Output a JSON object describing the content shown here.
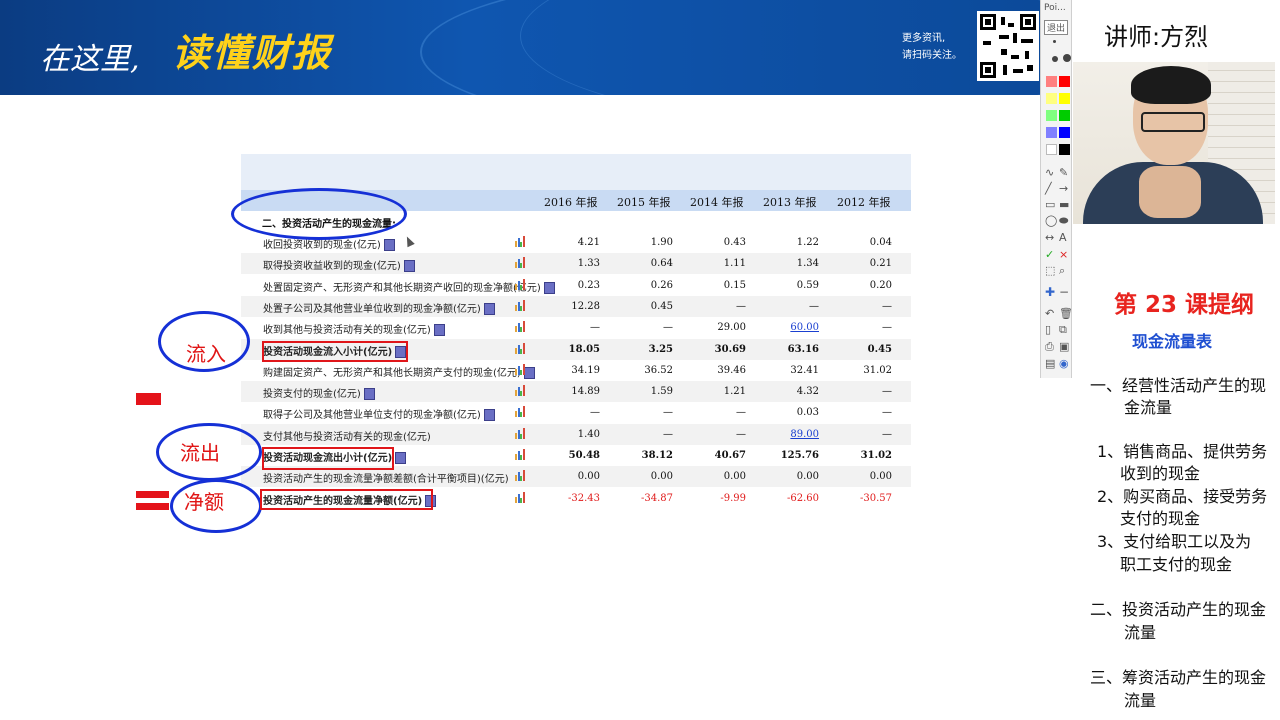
{
  "banner": {
    "slogan_white": "在这里,",
    "slogan_yellow": "读懂财报",
    "qr_text_1": "更多资讯,",
    "qr_text_2": "请扫码关注。"
  },
  "palette": {
    "top_label": "Poi...",
    "exit_label": "退出",
    "swatches": [
      "#ff8080",
      "#ff0000",
      "#ffff80",
      "#ffff00",
      "#80ff80",
      "#00cc00",
      "#8080ff",
      "#0000ff",
      "#ffffff",
      "#000000"
    ]
  },
  "teacher": "讲师:方烈",
  "outline": {
    "title": "第 23 课提纲",
    "subtitle": "现金流量表",
    "items": [
      "一、经营性活动产生的现",
      "金流量",
      "1、销售商品、提供劳务",
      "收到的现金",
      "2、购买商品、接受劳务",
      "支付的现金",
      "3、支付给职工以及为",
      "职工支付的现金",
      "二、投资活动产生的现金",
      "流量",
      "三、筹资活动产生的现金",
      "流量"
    ]
  },
  "table": {
    "years": [
      "2016 年报",
      "2015 年报",
      "2014 年报",
      "2013 年报",
      "2012 年报"
    ],
    "section_title": "二、投资活动产生的现金流量:",
    "rows": [
      {
        "label": "收回投资收到的现金(亿元)",
        "values": [
          "4.21",
          "1.90",
          "0.43",
          "1.22",
          "0.04"
        ]
      },
      {
        "label": "取得投资收益收到的现金(亿元)",
        "values": [
          "1.33",
          "0.64",
          "1.11",
          "1.34",
          "0.21"
        ]
      },
      {
        "label": "处置固定资产、无形资产和其他长期资产收回的现金净额(亿元)",
        "values": [
          "0.23",
          "0.26",
          "0.15",
          "0.59",
          "0.20"
        ]
      },
      {
        "label": "处置子公司及其他营业单位收到的现金净额(亿元)",
        "values": [
          "12.28",
          "0.45",
          "—",
          "—",
          "—"
        ]
      },
      {
        "label": "收到其他与投资活动有关的现金(亿元)",
        "values": [
          "—",
          "—",
          "29.00",
          "60.00",
          "—"
        ]
      },
      {
        "label": "投资活动现金流入小计(亿元)",
        "values": [
          "18.05",
          "3.25",
          "30.69",
          "63.16",
          "0.45"
        ]
      },
      {
        "label": "购建固定资产、无形资产和其他长期资产支付的现金(亿元)",
        "values": [
          "34.19",
          "36.52",
          "39.46",
          "32.41",
          "31.02"
        ]
      },
      {
        "label": "投资支付的现金(亿元)",
        "values": [
          "14.89",
          "1.59",
          "1.21",
          "4.32",
          "—"
        ]
      },
      {
        "label": "取得子公司及其他营业单位支付的现金净额(亿元)",
        "values": [
          "—",
          "—",
          "—",
          "0.03",
          "—"
        ]
      },
      {
        "label": "支付其他与投资活动有关的现金(亿元)",
        "values": [
          "1.40",
          "—",
          "—",
          "89.00",
          "—"
        ]
      },
      {
        "label": "投资活动现金流出小计(亿元)",
        "values": [
          "50.48",
          "38.12",
          "40.67",
          "125.76",
          "31.02"
        ]
      },
      {
        "label": "投资活动产生的现金流量净额差额(合计平衡项目)(亿元)",
        "values": [
          "0.00",
          "0.00",
          "0.00",
          "0.00",
          "0.00"
        ]
      },
      {
        "label": "投资活动产生的现金流量净额(亿元)",
        "values": [
          "-32.43",
          "-34.87",
          "-9.99",
          "-62.60",
          "-30.57"
        ]
      }
    ]
  },
  "annotations": {
    "inflow": "流入",
    "outflow": "流出",
    "net": "净额"
  }
}
